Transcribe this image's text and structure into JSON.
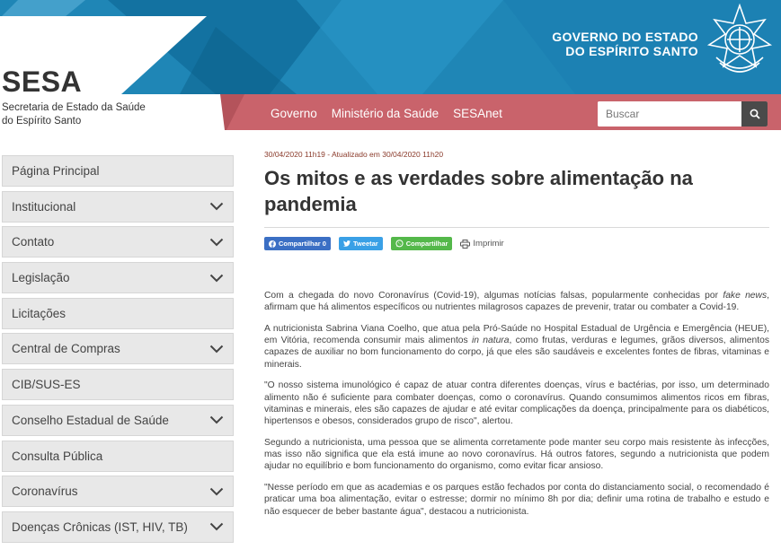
{
  "header": {
    "brand_title": "SESA",
    "brand_subtitle": "Secretaria de Estado da Saúde do Espírito Santo",
    "gov_line1": "GOVERNO DO ESTADO",
    "gov_line2": "DO ESPÍRITO SANTO",
    "nav": [
      "Governo",
      "Ministério da Saúde",
      "SESAnet"
    ],
    "search_placeholder": "Buscar"
  },
  "colors": {
    "header_blue": "#1f86b6",
    "header_dark_blue": "#0e6a98",
    "nav_pink": "#c9636b",
    "sidebar_bg": "#e8e8e8"
  },
  "sidebar": {
    "items": [
      {
        "label": "Página Principal",
        "expandable": false
      },
      {
        "label": "Institucional",
        "expandable": true
      },
      {
        "label": "Contato",
        "expandable": true
      },
      {
        "label": "Legislação",
        "expandable": true
      },
      {
        "label": "Licitações",
        "expandable": false
      },
      {
        "label": "Central de Compras",
        "expandable": true
      },
      {
        "label": "CIB/SUS-ES",
        "expandable": false
      },
      {
        "label": "Conselho Estadual de Saúde",
        "expandable": true
      },
      {
        "label": "Consulta Pública",
        "expandable": false
      },
      {
        "label": "Coronavírus",
        "expandable": true
      },
      {
        "label": "Doenças Crônicas (IST, HIV, TB)",
        "expandable": true
      }
    ]
  },
  "article": {
    "meta": "30/04/2020 11h19 - Atualizado em 30/04/2020 11h20",
    "title": "Os mitos e as verdades sobre alimentação na pandemia",
    "share": {
      "facebook": "Compartilhar 0",
      "twitter": "Tweetar",
      "whatsapp": "Compartilhar",
      "print": "Imprimir"
    },
    "p1_a": "Com a chegada do novo Coronavírus (Covid-19), algumas notícias falsas, popularmente conhecidas por ",
    "p1_em": "fake news",
    "p1_b": ", afirmam que há alimentos específicos ou nutrientes milagrosos capazes de prevenir, tratar ou combater a Covid-19.",
    "p2_a": "A nutricionista Sabrina Viana Coelho, que atua pela Pró-Saúde no Hospital Estadual de Urgência e Emergência (HEUE), em Vitória, recomenda consumir mais alimentos ",
    "p2_em": "in natura",
    "p2_b": ", como frutas, verduras e legumes, grãos diversos, alimentos capazes de auxiliar no bom funcionamento do corpo, já que eles são saudáveis e excelentes fontes de fibras, vitaminas e minerais.",
    "p3": "\"O nosso sistema imunológico é capaz de atuar contra diferentes doenças, vírus e bactérias, por isso, um determinado alimento não é suficiente para combater doenças, como o coronavírus. Quando consumimos alimentos ricos em fibras, vitaminas e minerais, eles são capazes de ajudar e até evitar complicações da doença, principalmente para os diabéticos, hipertensos e obesos, considerados grupo de risco\", alertou.",
    "p4": "Segundo a nutricionista, uma pessoa que se alimenta corretamente pode manter seu corpo mais resistente às infecções, mas isso não significa que ela está imune ao novo coronavírus. Há outros fatores, segundo a nutricionista que podem ajudar no equilíbrio e bom funcionamento do organismo, como evitar ficar ansioso.",
    "p5": "\"Nesse período em que as academias e os parques estão fechados por conta do distanciamento social, o recomendado é praticar uma boa alimentação, evitar o estresse; dormir no mínimo 8h por dia; definir uma rotina de trabalho e estudo e não esquecer de beber bastante água\", destacou a nutricionista."
  }
}
